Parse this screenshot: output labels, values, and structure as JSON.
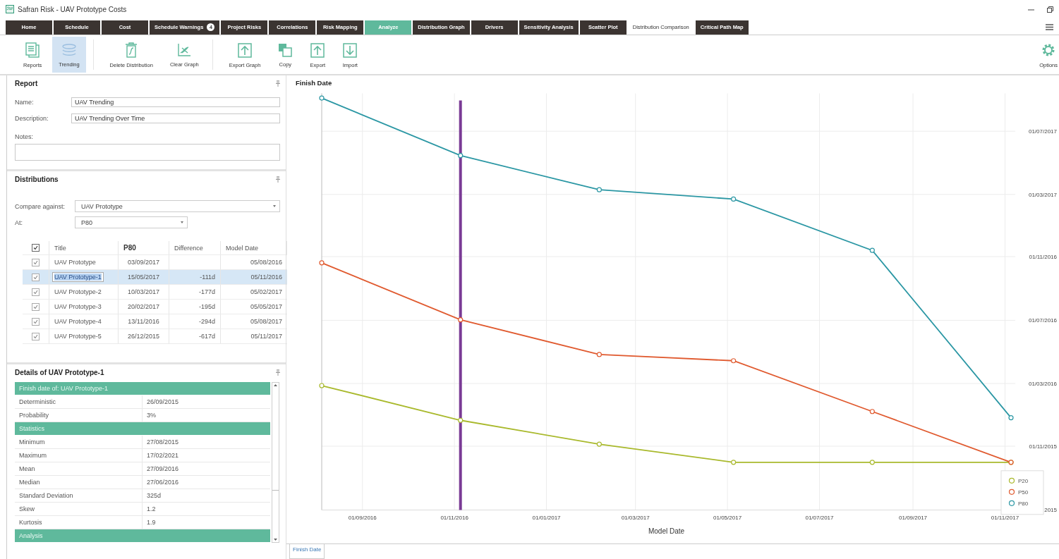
{
  "window": {
    "title": "Safran Risk - UAV Prototype Costs"
  },
  "tabs": [
    {
      "label": "Home",
      "selected": false,
      "highlighted": false
    },
    {
      "label": "Schedule",
      "selected": false,
      "highlighted": false
    },
    {
      "label": "Cost",
      "selected": false,
      "highlighted": false
    },
    {
      "label": "Schedule Warnings",
      "badge": "4",
      "selected": false,
      "highlighted": false
    },
    {
      "label": "Project Risks",
      "selected": false,
      "highlighted": false
    },
    {
      "label": "Correlations",
      "selected": false,
      "highlighted": false
    },
    {
      "label": "Risk Mapping",
      "selected": false,
      "highlighted": false
    },
    {
      "label": "Analyze",
      "selected": false,
      "highlighted": true
    },
    {
      "label": "Distribution Graph",
      "selected": false,
      "highlighted": false
    },
    {
      "label": "Drivers",
      "selected": false,
      "highlighted": false
    },
    {
      "label": "Sensitivity Analysis",
      "selected": false,
      "highlighted": false
    },
    {
      "label": "Scatter Plot",
      "selected": false,
      "highlighted": false
    },
    {
      "label": "Distribution Comparison",
      "selected": true,
      "highlighted": false
    },
    {
      "label": "Critical Path Map",
      "selected": false,
      "highlighted": false
    }
  ],
  "toolbar": [
    {
      "label": "Reports",
      "selected": false
    },
    {
      "label": "Trending",
      "selected": true
    },
    {
      "label": "Delete Distribution",
      "selected": false
    },
    {
      "label": "Clear Graph",
      "selected": false
    },
    {
      "label": "Export Graph",
      "selected": false
    },
    {
      "label": "Copy",
      "selected": false
    },
    {
      "label": "Export",
      "selected": false
    },
    {
      "label": "Import",
      "selected": false
    }
  ],
  "options": {
    "label": "Options"
  },
  "report": {
    "title": "Report",
    "name_label": "Name:",
    "name": "UAV Trending",
    "description_label": "Description:",
    "description": "UAV Trending Over Time",
    "notes_label": "Notes:"
  },
  "distributions": {
    "title": "Distributions",
    "compare_label": "Compare against:",
    "compare": "UAV Prototype",
    "at_label": "At:",
    "at": "P80",
    "all_checked": true,
    "columns": [
      "Title",
      "P80",
      "Difference",
      "Model Date"
    ],
    "rows": [
      {
        "checked": true,
        "selected": false,
        "title": "UAV Prototype",
        "p80": "03/09/2017",
        "model_date": "05/08/2016"
      },
      {
        "checked": true,
        "selected": true,
        "title": "UAV Prototype-1",
        "p80": "15/05/2017",
        "difference": "-111d",
        "model_date": "05/11/2016"
      },
      {
        "checked": true,
        "selected": false,
        "title": "UAV Prototype-2",
        "p80": "10/03/2017",
        "difference": "-177d",
        "model_date": "05/02/2017"
      },
      {
        "checked": true,
        "selected": false,
        "title": "UAV Prototype-3",
        "p80": "20/02/2017",
        "difference": "-195d",
        "model_date": "05/05/2017"
      },
      {
        "checked": true,
        "selected": false,
        "title": "UAV Prototype-4",
        "p80": "13/11/2016",
        "difference": "-294d",
        "model_date": "05/08/2017"
      },
      {
        "checked": true,
        "selected": false,
        "title": "UAV Prototype-5",
        "p80": "26/12/2015",
        "difference": "-617d",
        "model_date": "05/11/2017"
      }
    ]
  },
  "details": {
    "title": "Details of UAV Prototype-1",
    "rows": [
      {
        "kind": "section",
        "label": "Finish date of: UAV Prototype-1"
      },
      {
        "kind": "item",
        "label": "Deterministic",
        "value": "26/09/2015"
      },
      {
        "kind": "item",
        "label": "Probability",
        "value": "3%"
      },
      {
        "kind": "section",
        "label": "Statistics"
      },
      {
        "kind": "item",
        "label": "Minimum",
        "value": "27/08/2015"
      },
      {
        "kind": "item",
        "label": "Maximum",
        "value": "17/02/2021"
      },
      {
        "kind": "item",
        "label": "Mean",
        "value": "27/09/2016"
      },
      {
        "kind": "item",
        "label": "Median",
        "value": "27/06/2016"
      },
      {
        "kind": "item",
        "label": "Standard Deviation",
        "value": "325d"
      },
      {
        "kind": "item",
        "label": "Skew",
        "value": "1.2"
      },
      {
        "kind": "item",
        "label": "Kurtosis",
        "value": "1.9"
      },
      {
        "kind": "section",
        "label": "Analysis"
      }
    ]
  },
  "chart": {
    "title": "Finish Date",
    "xlabel": "Model Date",
    "series": [
      {
        "name": "P20",
        "color": "#a9b92c"
      },
      {
        "name": "P50",
        "color": "#e05a2f"
      },
      {
        "name": "P80",
        "color": "#2b97a4"
      }
    ],
    "x_tick_labels": [
      "01/09/2016",
      "01/11/2016",
      "01/01/2017",
      "01/03/2017",
      "01/05/2017",
      "01/07/2017",
      "01/09/2017",
      "01/11/2017"
    ],
    "y_tick_labels": [
      "01/07/2017",
      "01/03/2017",
      "01/11/2016",
      "01/07/2016",
      "01/03/2016",
      "01/11/2015",
      "2015"
    ]
  },
  "bottom_tabs": [
    {
      "label": "Finish Date",
      "selected": true
    }
  ]
}
